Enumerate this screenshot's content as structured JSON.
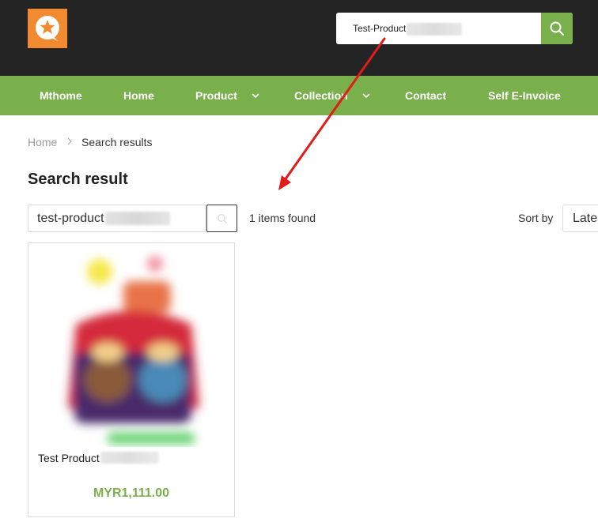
{
  "header": {
    "search_value": "Test-Product",
    "colors": {
      "topbar": "#242424",
      "accent": "#7ab04c",
      "logo": "#f28a30"
    },
    "logo_icon": "star-chat-icon",
    "search_icon": "search-icon"
  },
  "nav": {
    "items": [
      {
        "label": "Mthome",
        "has_dropdown": false
      },
      {
        "label": "Home",
        "has_dropdown": false
      },
      {
        "label": "Product",
        "has_dropdown": true
      },
      {
        "label": "Collection",
        "has_dropdown": true
      },
      {
        "label": "Contact",
        "has_dropdown": false
      },
      {
        "label": "Self E-Invoice",
        "has_dropdown": false
      }
    ]
  },
  "breadcrumb": {
    "home": "Home",
    "current": "Search results"
  },
  "page": {
    "title": "Search result",
    "search_value": "test-product",
    "items_found": "1 items found",
    "sort_label": "Sort by",
    "sort_value": "Latest"
  },
  "products": [
    {
      "name": "Test Product",
      "price": "MYR1,111.00"
    }
  ]
}
